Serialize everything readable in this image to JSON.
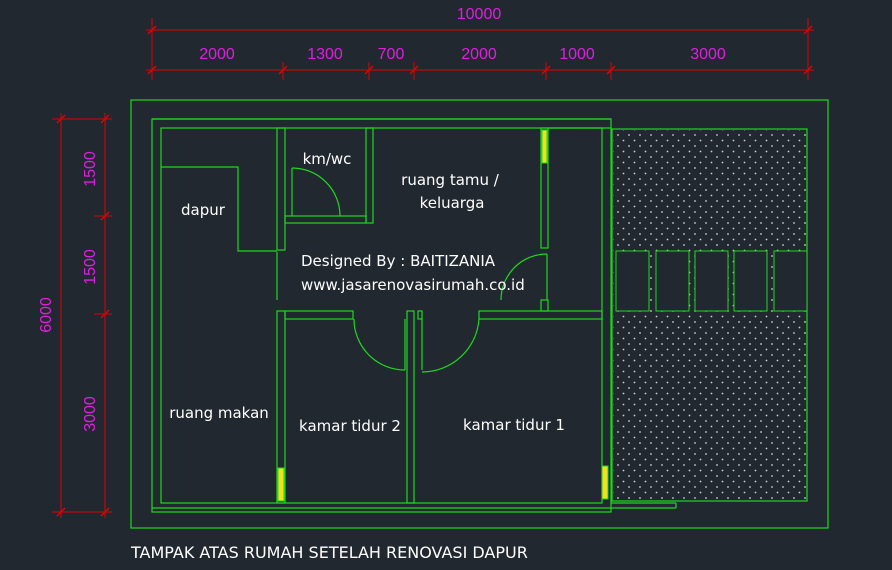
{
  "drawing": {
    "caption": "TAMPAK ATAS RUMAH SETELAH RENOVASI DAPUR",
    "credit_line1": "Designed By : BAITIZANIA",
    "credit_line2": "www.jasarenovasirumah.co.id"
  },
  "dimensions": {
    "total_width": "10000",
    "top_segments": [
      "2000",
      "1300",
      "700",
      "2000",
      "1000",
      "3000"
    ],
    "total_height": "6000",
    "left_segments": [
      "1500",
      "1500",
      "3000"
    ]
  },
  "rooms": {
    "kmwc": "km/wc",
    "ruang_tamu_line1": "ruang tamu /",
    "ruang_tamu_line2": "keluarga",
    "dapur": "dapur",
    "ruang_makan": "ruang makan",
    "kamar2": "kamar tidur 2",
    "kamar1": "kamar tidur 1"
  },
  "colors": {
    "background": "#212830",
    "walls": "#1ed81e",
    "dimension_text": "#e01ee0",
    "dimension_lines": "#e00000",
    "window": "#f0e020",
    "text": "#ffffff"
  }
}
